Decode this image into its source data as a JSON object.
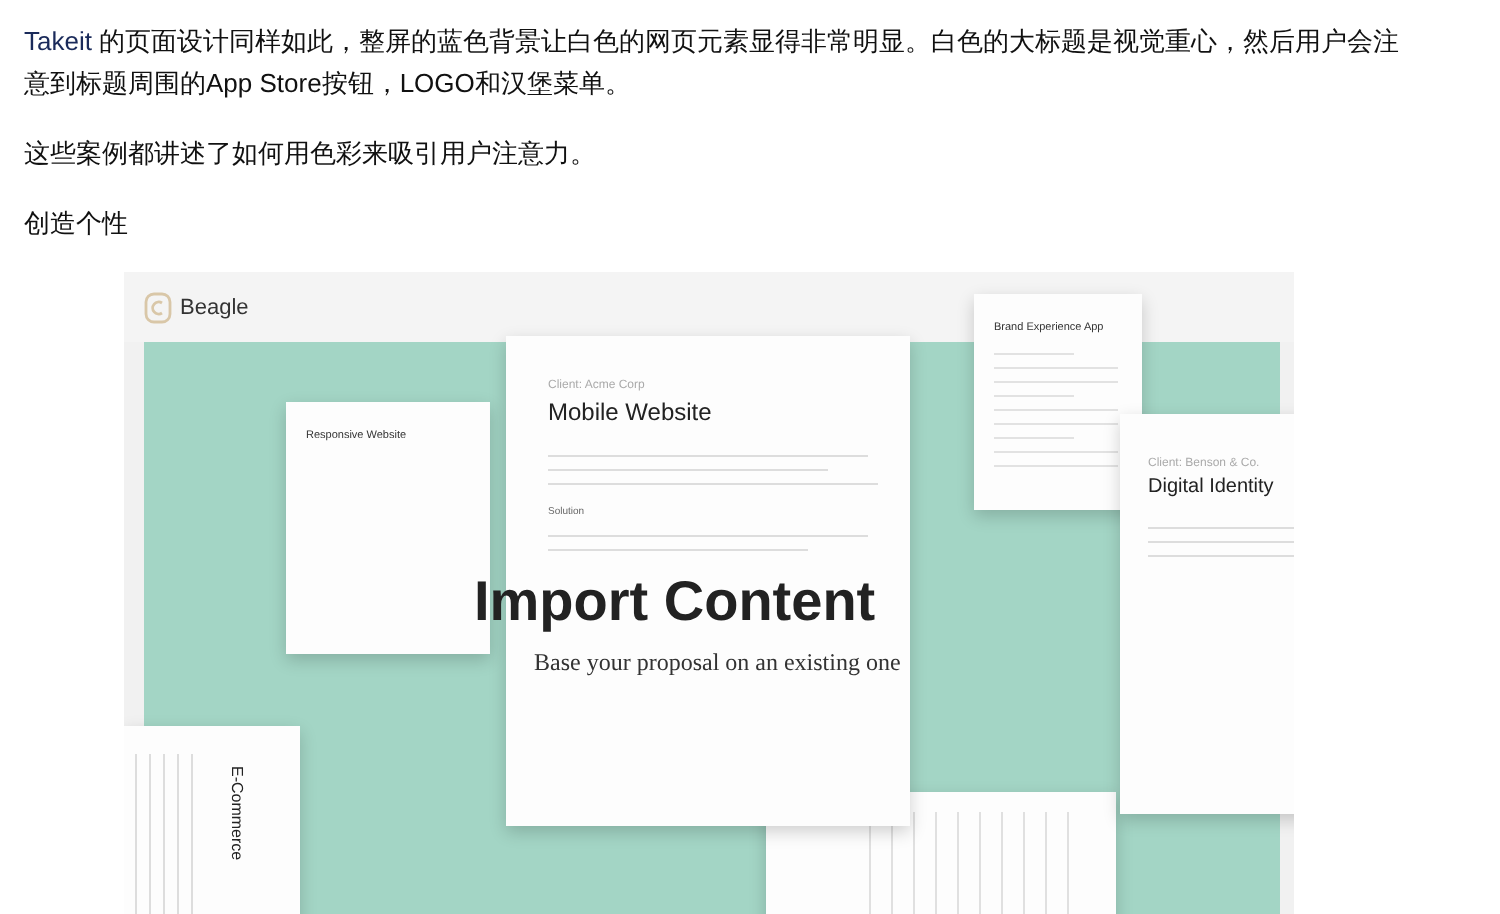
{
  "paragraphs": [
    {
      "link": "Takeit",
      "text": " 的页面设计同样如此，整屏的蓝色背景让白色的网页元素显得非常明显。白色的大标题是视觉重心，然后用户会注意到标题周围的App Store按钮，LOGO和汉堡菜单。"
    },
    {
      "text": "这些案例都讲述了如何用色彩来吸引用户注意力。"
    }
  ],
  "heading": "创造个性",
  "image": {
    "brand": "Beagle",
    "headline": "Import Content",
    "subtitle": "Base your proposal on an existing one",
    "cards": [
      {
        "kind": "small",
        "title": "Responsive Website"
      },
      {
        "kind": "large",
        "client": "Client: Acme Corp",
        "title": "Mobile Website",
        "section": "Solution"
      },
      {
        "kind": "small",
        "title": "Brand Experience App"
      },
      {
        "kind": "large",
        "client": "Client: Benson & Co.",
        "title": "Digital Identity"
      },
      {
        "kind": "rotated",
        "title": "E-Commerce"
      }
    ]
  }
}
